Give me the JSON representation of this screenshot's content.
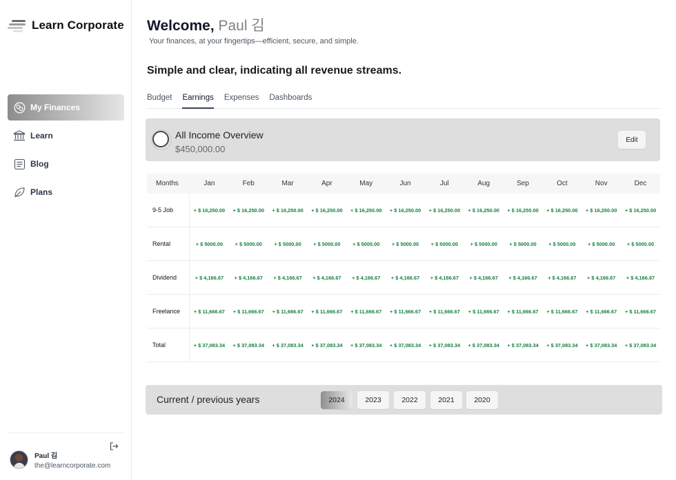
{
  "brand": {
    "name": "Learn Corporate"
  },
  "sidebar": {
    "items": [
      {
        "label": "My Finances",
        "icon": "finances-icon",
        "active": true
      },
      {
        "label": "Learn",
        "icon": "bank-icon"
      },
      {
        "label": "Blog",
        "icon": "blog-icon"
      },
      {
        "label": "Plans",
        "icon": "leaf-icon"
      }
    ],
    "user": {
      "name": "Paul 김",
      "email": "the@learncorporate.com"
    }
  },
  "header": {
    "welcome": "Welcome,",
    "name": "Paul 김",
    "tagline": "Your finances, at your fingertips—efficient, secure, and simple."
  },
  "section": {
    "title": "Simple and clear, indicating all revenue streams."
  },
  "tabs": [
    {
      "label": "Budget"
    },
    {
      "label": "Earnings",
      "active": true
    },
    {
      "label": "Expenses"
    },
    {
      "label": "Dashboards"
    }
  ],
  "overview": {
    "title": "All Income Overview",
    "amount": "$450,000.00",
    "edit_label": "Edit"
  },
  "table": {
    "header_label": "Months",
    "months": [
      "Jan",
      "Feb",
      "Mar",
      "Apr",
      "May",
      "Jun",
      "Jul",
      "Aug",
      "Sep",
      "Oct",
      "Nov",
      "Dec"
    ],
    "rows": [
      {
        "label": "9-5 Job",
        "values": [
          "+ $ 16,250.00",
          "+ $ 16,250.00",
          "+ $ 16,250.00",
          "+ $ 16,250.00",
          "+ $ 16,250.00",
          "+ $ 16,250.00",
          "+ $ 16,250.00",
          "+ $ 16,250.00",
          "+ $ 16,250.00",
          "+ $ 16,250.00",
          "+ $ 16,250.00",
          "+ $ 16,250.00"
        ]
      },
      {
        "label": "Rental",
        "values": [
          "+ $ 5000.00",
          "+ $ 5000.00",
          "+ $ 5000.00",
          "+ $ 5000.00",
          "+ $ 5000.00",
          "+ $ 5000.00",
          "+ $ 5000.00",
          "+ $ 5000.00",
          "+ $ 5000.00",
          "+ $ 5000.00",
          "+ $ 5000.00",
          "+ $ 5000.00"
        ]
      },
      {
        "label": "Dividend",
        "values": [
          "+ $ 4,166.67",
          "+ $ 4,166.67",
          "+ $ 4,166.67",
          "+ $ 4,166.67",
          "+ $ 4,166.67",
          "+ $ 4,166.67",
          "+ $ 4,166.67",
          "+ $ 4,166.67",
          "+ $ 4,166.67",
          "+ $ 4,166.67",
          "+ $ 4,166.67",
          "+ $ 4,166.67"
        ]
      },
      {
        "label": "Freelance",
        "values": [
          "+ $ 11,666.67",
          "+ $ 11,666.67",
          "+ $ 11,666.67",
          "+ $ 11,666.67",
          "+ $ 11,666.67",
          "+ $ 11,666.67",
          "+ $ 11,666.67",
          "+ $ 11,666.67",
          "+ $ 11,666.67",
          "+ $ 11,666.67",
          "+ $ 11,666.67",
          "+ $ 11,666.67"
        ]
      },
      {
        "label": "Total",
        "values": [
          "+ $ 37,083.34",
          "+ $ 37,083.34",
          "+ $ 37,083.34",
          "+ $ 37,083.34",
          "+ $ 37,083.34",
          "+ $ 37,083.34",
          "+ $ 37,083.34",
          "+ $ 37,083.34",
          "+ $ 37,083.34",
          "+ $ 37,083.34",
          "+ $ 37,083.34",
          "+ $ 37,083.34"
        ]
      }
    ]
  },
  "years": {
    "title": "Current / previous years",
    "options": [
      {
        "label": "2024",
        "active": true
      },
      {
        "label": "2023"
      },
      {
        "label": "2022"
      },
      {
        "label": "2021"
      },
      {
        "label": "2020"
      }
    ]
  },
  "colors": {
    "positive": "#15803d",
    "active_gradient_start": "#8c8c8c",
    "panel_bg": "#dedede"
  }
}
